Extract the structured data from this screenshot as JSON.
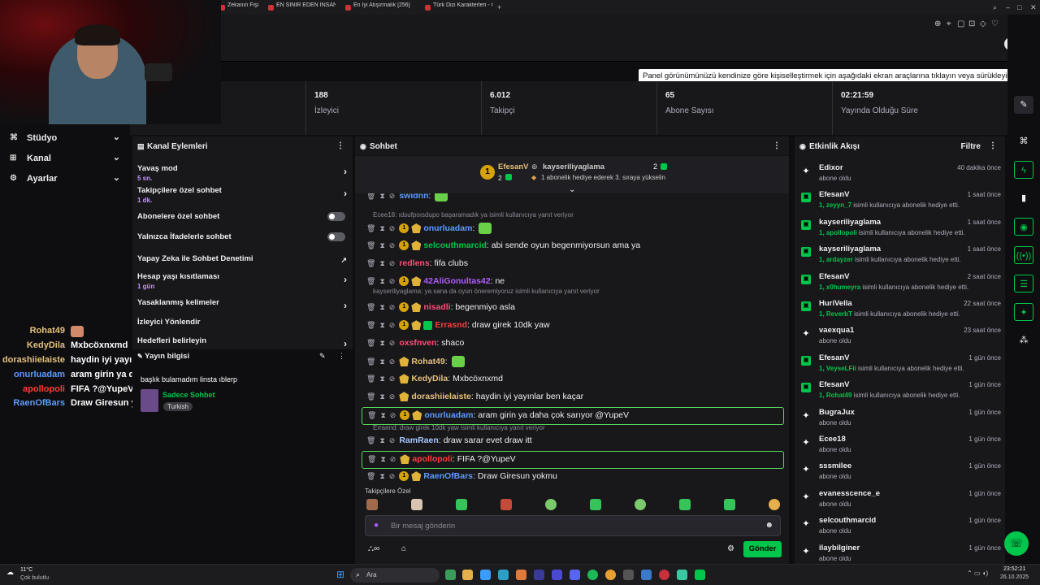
{
  "browser": {
    "tabs": [
      "Zekanın Fişini Ç",
      "EN SİNİR EDEN İNSAN Tİ",
      "En İyi Atışırmalık [256]",
      "Türk Dizi Karakterleri - G"
    ],
    "new_tab": "+"
  },
  "tooltip": "Panel görünümünüzü kendinize göre kişiselleştirmek için aşağıdaki ekran araçlarına tıklayın veya sürükleyin",
  "stats": [
    {
      "value": "188",
      "label": "İzleyici"
    },
    {
      "value": "6.012",
      "label": "Takipçi"
    },
    {
      "value": "65",
      "label": "Abone Sayısı"
    },
    {
      "value": "02:21:59",
      "label": "Yayında Olduğu Süre"
    }
  ],
  "nav": [
    {
      "label": "Stüdyo",
      "icon": "studio-icon"
    },
    {
      "label": "Kanal",
      "icon": "channel-icon"
    },
    {
      "label": "Ayarlar",
      "icon": "gear-icon"
    }
  ],
  "overlay_chat": [
    {
      "name": "Rohat49",
      "msg": "",
      "color": "#e5c07b"
    },
    {
      "name": "KedyDila",
      "msg": "Mxbcöxnxmd",
      "color": "#e5c07b"
    },
    {
      "name": "dorashiielaiste",
      "msg": "haydin iyi yayınlar ben kaçar",
      "color": "#e5c07b"
    },
    {
      "name": "onurluadam",
      "msg": "aram girin ya daha çok sarıyor @YupeV",
      "color": "#5b9bff"
    },
    {
      "name": "apollopoli",
      "msg": "FIFA ?@YupeV",
      "color": "#ff3b3b"
    },
    {
      "name": "RaenOfBars",
      "msg": "Draw Giresun yokmu",
      "color": "#5b9bff"
    }
  ],
  "channel_actions": {
    "title": "Kanal Eylemleri",
    "items": [
      {
        "label": "Yavaş mod",
        "sub": "5 sn.",
        "control": "arrow"
      },
      {
        "label": "Takipçilere özel sohbet",
        "sub": "1 dk.",
        "control": "arrow"
      },
      {
        "label": "Abonelere özel sohbet",
        "sub": "",
        "control": "toggle"
      },
      {
        "label": "Yalnızca İfadelerle sohbet",
        "sub": "",
        "control": "toggle"
      },
      {
        "label": "Yapay Zeka ile Sohbet Denetimi",
        "sub": "",
        "control": "external"
      },
      {
        "label": "Hesap yaşı kısıtlaması",
        "sub": "1 gün",
        "control": "arrow"
      },
      {
        "label": "Yasaklanmış kelimeler",
        "sub": "",
        "control": "arrow"
      },
      {
        "label": "İzleyici Yönlendir",
        "sub": "",
        "control": "none"
      },
      {
        "label": "Hedefleri belirleyin",
        "sub": "",
        "control": "arrow"
      }
    ]
  },
  "stream_info": {
    "title": "Yayın bilgisi",
    "stream_title": "başlık bulamadım linsta ıblerp",
    "mode": "Sadece Sohbet",
    "language": "Turkish"
  },
  "chat": {
    "title": "Sohbet",
    "hype_left": {
      "name": "EfesanV",
      "count": "2"
    },
    "hype_right": {
      "name": "kayseriliyaglama",
      "count": "2",
      "text": "1 abonelik hediye ederek 3. sıraya yükselin"
    },
    "messages": [
      {
        "kind": "msg",
        "name": "swidnn",
        "text": "",
        "color": "#5b9bff",
        "badges": "shield"
      },
      {
        "kind": "reply",
        "text": "Ecee18: ıdsufpoısdupo başaramadık ya isimli kullanıcıya yanıt veriyor"
      },
      {
        "kind": "msg",
        "name": "onurluadam",
        "text": "",
        "color": "#5b9bff",
        "badges": "sub"
      },
      {
        "kind": "msg",
        "name": "selcouthmarcid",
        "text": "abi sende oyun begenmiyorsun ama ya",
        "color": "#00c74c",
        "badges": "sub"
      },
      {
        "kind": "msg",
        "name": "redlens",
        "text": "fifa clubs",
        "color": "#ff4b78",
        "badges": "shield"
      },
      {
        "kind": "msg",
        "name": "42AliGonultas42",
        "text": "ne",
        "color": "#b05bff",
        "badges": "sub"
      },
      {
        "kind": "reply",
        "text": "kayseriliyaglama: ya sana da oyun öneremiyoruz isimli kullanıcıya yanıt veriyor"
      },
      {
        "kind": "msg",
        "name": "nisadli",
        "text": "begenmiyo asla",
        "color": "#ff4b78",
        "badges": "sub"
      },
      {
        "kind": "msg",
        "name": "Errasnd",
        "text": "draw girek 10dk yaw",
        "color": "#ff3b3b",
        "badges": "subg"
      },
      {
        "kind": "msg",
        "name": "oxsfnven",
        "text": "shaco",
        "color": "#ff4b78",
        "badges": "shield"
      },
      {
        "kind": "msg",
        "name": "Rohat49",
        "text": "",
        "color": "#e5c07b",
        "badges": "vip"
      },
      {
        "kind": "msg",
        "name": "KedyDila",
        "text": "Mxbcöxnxmd",
        "color": "#e5c07b",
        "badges": "vip"
      },
      {
        "kind": "msg",
        "name": "dorashiielaiste",
        "text": "haydin iyi yayınlar ben kaçar",
        "color": "#e5c07b",
        "badges": "vip"
      },
      {
        "kind": "hl",
        "name": "onurluadam",
        "text": "aram girin ya daha çok sarıyor @YupeV",
        "color": "#5b9bff",
        "badges": "sub"
      },
      {
        "kind": "reply",
        "text": "Erraend: draw girek 10dk yaw isimli kullanıcıya yanıt veriyor"
      },
      {
        "kind": "msg",
        "name": "RamRaen",
        "text": "draw sarar evet draw itt",
        "color": "#a7c7ff",
        "badges": "none"
      },
      {
        "kind": "hl",
        "name": "apollopoli",
        "text": "FIFA ?@YupeV",
        "color": "#ff3b3b",
        "badges": "vip"
      },
      {
        "kind": "msg",
        "name": "RaenOfBars",
        "text": "Draw Giresun yokmu",
        "color": "#5b9bff",
        "badges": "sub"
      }
    ],
    "emote_label": "Takipçilere Özel",
    "input_placeholder": "Bir mesaj gönderin",
    "send_label": "Gönder"
  },
  "activity": {
    "title": "Etkinlik Akışı",
    "filter": "Filtre",
    "events": [
      {
        "name": "Edixor",
        "time": "40 dakika önce",
        "count": "",
        "sub": "abone oldu",
        "icon": "star"
      },
      {
        "name": "EfesanV",
        "time": "1 saat önce",
        "count": "1, zeyyn_7",
        "sub": "isimli kullanıcıya abonelik hediye etti.",
        "icon": "gift"
      },
      {
        "name": "kayseriliyaglama",
        "time": "1 saat önce",
        "count": "1, apollopoli",
        "sub": "isimli kullanıcıya abonelik hediye etti.",
        "icon": "gift"
      },
      {
        "name": "kayseriliyaglama",
        "time": "1 saat önce",
        "count": "1, ardayzer",
        "sub": "isimli kullanıcıya abonelik hediye etti.",
        "icon": "gift"
      },
      {
        "name": "EfesanV",
        "time": "2 saat önce",
        "count": "1, x0humeyra",
        "sub": "isimli kullanıcıya abonelik hediye etti.",
        "icon": "gift"
      },
      {
        "name": "HuriVella",
        "time": "22 saat önce",
        "count": "1, ReverbT",
        "sub": "isimli kullanıcıya abonelik hediye etti.",
        "icon": "gift"
      },
      {
        "name": "vaexqua1",
        "time": "23 saat önce",
        "count": "",
        "sub": "abone oldu",
        "icon": "star"
      },
      {
        "name": "EfesanV",
        "time": "1 gün önce",
        "count": "1, VeyseLFii",
        "sub": "isimli kullanıcıya abonelik hediye etti.",
        "icon": "gift"
      },
      {
        "name": "EfesanV",
        "time": "1 gün önce",
        "count": "1, Rohat49",
        "sub": "isimli kullanıcıya abonelik hediye etti.",
        "icon": "gift"
      },
      {
        "name": "BugraJux",
        "time": "1 gün önce",
        "count": "",
        "sub": "abone oldu",
        "icon": "star"
      },
      {
        "name": "Ecee18",
        "time": "1 gün önce",
        "count": "",
        "sub": "abone oldu",
        "icon": "star"
      },
      {
        "name": "sssmilee",
        "time": "1 gün önce",
        "count": "",
        "sub": "abone oldu",
        "icon": "star"
      },
      {
        "name": "evanesscence_e",
        "time": "1 gün önce",
        "count": "",
        "sub": "abone oldu",
        "icon": "star"
      },
      {
        "name": "selcouthmarcid",
        "time": "1 gün önce",
        "count": "",
        "sub": "abone oldu",
        "icon": "star"
      },
      {
        "name": "ilaybilginer",
        "time": "1 gün önce",
        "count": "",
        "sub": "abone oldu",
        "icon": "star"
      }
    ]
  },
  "taskbar": {
    "weather_temp": "11°C",
    "weather_desc": "Çok bulutlu",
    "search": "Ara",
    "time": "23:52:21",
    "date": "26.10.2025"
  },
  "colors": {
    "accent": "#00c74c",
    "bg": "#0e0e10",
    "panel": "#18181b"
  }
}
